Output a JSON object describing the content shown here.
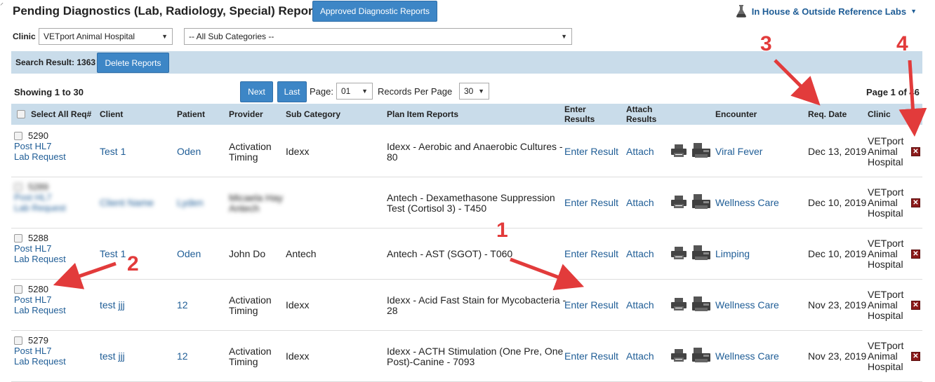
{
  "header": {
    "title": "Pending Diagnostics (Lab, Radiology, Special) Reports",
    "approved_button": "Approved Diagnostic Reports",
    "labs_menu": "In House & Outside Reference Labs"
  },
  "filters": {
    "clinic_label": "Clinic",
    "clinic_value": "VETport Animal Hospital",
    "subcategory_value": "-- All Sub Categories --"
  },
  "search": {
    "result_label": "Search Result: 1363",
    "delete_button": "Delete Reports"
  },
  "pager": {
    "showing": "Showing 1 to 30",
    "next": "Next",
    "last": "Last",
    "page_label": "Page:",
    "page_value": "01",
    "rpp_label": "Records Per Page",
    "rpp_value": "30",
    "page_of": "Page 1 of 46"
  },
  "columns": {
    "select_all": "Select All Req#",
    "client": "Client",
    "patient": "Patient",
    "provider": "Provider",
    "sub_category": "Sub Category",
    "plan_item": "Plan Item Reports",
    "enter_results_1": "Enter",
    "enter_results_2": "Results",
    "attach_results_1": "Attach",
    "attach_results_2": "Results",
    "encounter": "Encounter",
    "req_date": "Req. Date",
    "clinic": "Clinic"
  },
  "rows": [
    {
      "req": "5290",
      "hl7_1": "Post HL7",
      "hl7_2": "Lab Request",
      "client": "Test 1",
      "patient": "Oden",
      "provider_1": "Activation",
      "provider_2": "Timing",
      "subcat": "Idexx",
      "plan_1": "Idexx - Aerobic and Anaerobic Cultures -",
      "plan_2": "80",
      "enter": "Enter Result",
      "attach": "Attach",
      "encounter": "Viral Fever",
      "date": "Dec 13, 2019",
      "clinic_1": "VETport",
      "clinic_2": "Animal",
      "clinic_3": "Hospital"
    },
    {
      "req": "5289",
      "hl7_1": "Post HL7",
      "hl7_2": "Lab Request",
      "client": "Client Name",
      "patient": "Lyden",
      "provider_1": "Micaela Hay",
      "provider_2": "Antech",
      "subcat": "",
      "plan_1": "Antech - Dexamethasone Suppression",
      "plan_2": "Test (Cortisol 3) - T450",
      "enter": "Enter Result",
      "attach": "Attach",
      "encounter": "Wellness Care",
      "date": "Dec 10, 2019",
      "clinic_1": "VETport",
      "clinic_2": "Animal",
      "clinic_3": "Hospital"
    },
    {
      "req": "5288",
      "hl7_1": "Post HL7",
      "hl7_2": "Lab Request",
      "client": "Test 1",
      "patient": "Oden",
      "provider_1": "John Do",
      "provider_2": "",
      "subcat": "Antech",
      "plan_1": "Antech - AST (SGOT) - T060",
      "plan_2": "",
      "enter": "Enter Result",
      "attach": "Attach",
      "encounter": "Limping",
      "date": "Dec 10, 2019",
      "clinic_1": "VETport",
      "clinic_2": "Animal",
      "clinic_3": "Hospital"
    },
    {
      "req": "5280",
      "hl7_1": "Post HL7",
      "hl7_2": "Lab Request",
      "client": "test jjj",
      "patient": "12",
      "provider_1": "Activation",
      "provider_2": "Timing",
      "subcat": "Idexx",
      "plan_1": "Idexx - Acid Fast Stain for Mycobacteria -",
      "plan_2": "28",
      "enter": "Enter Result",
      "attach": "Attach",
      "encounter": "Wellness Care",
      "date": "Nov 23, 2019",
      "clinic_1": "VETport",
      "clinic_2": "Animal",
      "clinic_3": "Hospital"
    },
    {
      "req": "5279",
      "hl7_1": "Post HL7",
      "hl7_2": "Lab Request",
      "client": "test jjj",
      "patient": "12",
      "provider_1": "Activation",
      "provider_2": "Timing",
      "subcat": "Idexx",
      "plan_1": "Idexx - ACTH Stimulation (One Pre, One",
      "plan_2": "Post)-Canine - 7093",
      "enter": "Enter Result",
      "attach": "Attach",
      "encounter": "Wellness Care",
      "date": "Nov 23, 2019",
      "clinic_1": "VETport",
      "clinic_2": "Animal",
      "clinic_3": "Hospital"
    }
  ],
  "annotations": [
    "1",
    "2",
    "3",
    "4"
  ],
  "icons": {
    "printer": "printer-icon",
    "fax": "fax-icon",
    "delete": "delete-x-icon",
    "flask": "flask-icon"
  }
}
